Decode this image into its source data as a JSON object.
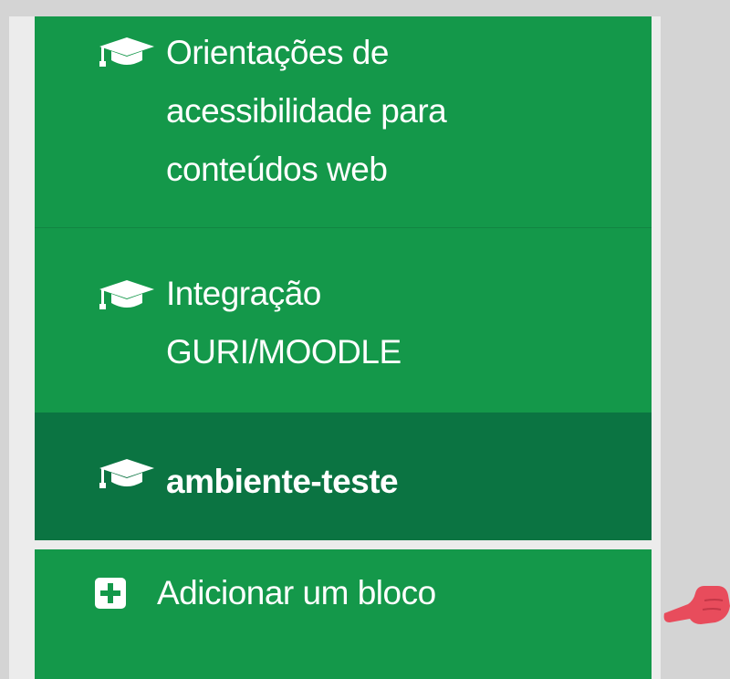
{
  "nav": {
    "items": [
      {
        "label_line1": "Orientações de",
        "label_line2": "acessibilidade para",
        "label_line3": "conteúdos web",
        "icon": "graduation-cap-icon"
      },
      {
        "label_line1": "Integração",
        "label_line2": "GURI/MOODLE",
        "icon": "graduation-cap-icon"
      },
      {
        "label_line1": "ambiente-teste",
        "icon": "graduation-cap-icon",
        "active": true
      }
    ]
  },
  "add_block": {
    "label": "Adicionar um bloco",
    "icon": "plus-square-icon"
  },
  "annotation": {
    "icon": "pointing-hand-icon"
  },
  "colors": {
    "nav_green": "#14984a",
    "nav_active": "#0b7442",
    "sidebar_bg": "#ececec",
    "page_bg": "#d4d4d4",
    "arrow": "#e84c5c"
  }
}
